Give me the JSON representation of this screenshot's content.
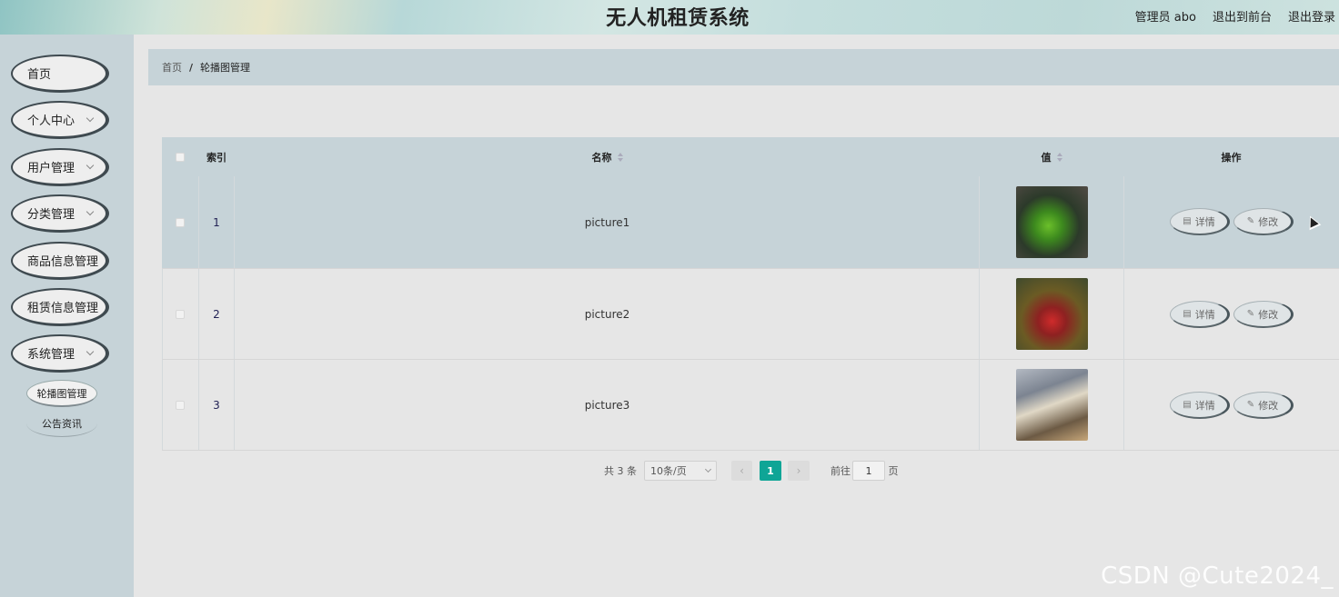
{
  "header": {
    "title": "无人机租赁系统",
    "admin_label": "管理员 abo",
    "to_front_label": "退出到前台",
    "logout_label": "退出登录"
  },
  "sidebar": {
    "items": [
      {
        "label": "首页"
      },
      {
        "label": "个人中心"
      },
      {
        "label": "用户管理"
      },
      {
        "label": "分类管理"
      },
      {
        "label": "商品信息管理"
      },
      {
        "label": "租赁信息管理"
      },
      {
        "label": "系统管理"
      }
    ],
    "sub_items": [
      {
        "label": "轮播图管理",
        "active": true
      },
      {
        "label": "公告资讯",
        "active": false
      }
    ]
  },
  "breadcrumb": {
    "home": "首页",
    "separator": "/",
    "current": "轮播图管理"
  },
  "table": {
    "columns": {
      "index": "索引",
      "name": "名称",
      "value": "值",
      "actions": "操作"
    },
    "rows": [
      {
        "index": "1",
        "name": "picture1",
        "thumb": "green-race-car-image"
      },
      {
        "index": "2",
        "name": "picture2",
        "thumb": "red-race-car-image"
      },
      {
        "index": "3",
        "name": "picture3",
        "thumb": "white-race-car-image"
      }
    ],
    "detail_label": "详情",
    "edit_label": "修改"
  },
  "pagination": {
    "total": "共 3 条",
    "page_size": "10条/页",
    "current_page": "1",
    "goto_label": "前往",
    "goto_value": "1",
    "page_suffix": "页"
  },
  "watermark": "CSDN @Cute2024_",
  "colors": {
    "accent": "#0fa596",
    "panel": "#c6d3d8",
    "background": "#e6e6e6"
  }
}
